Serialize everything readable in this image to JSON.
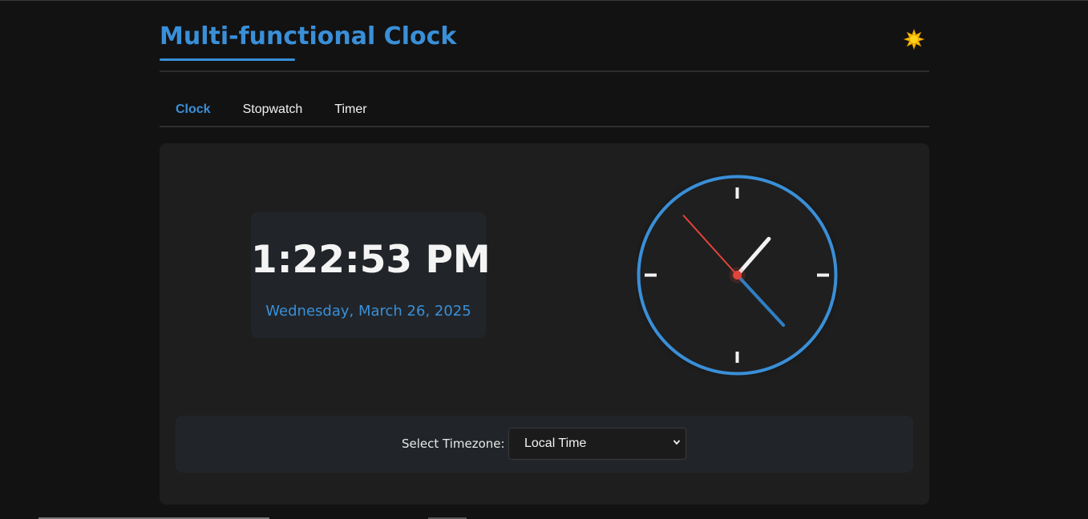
{
  "header": {
    "title": "Multi-functional Clock",
    "theme_toggle_icon": "sun-icon"
  },
  "tabs": [
    {
      "label": "Clock",
      "active": true
    },
    {
      "label": "Stopwatch",
      "active": false
    },
    {
      "label": "Timer",
      "active": false
    }
  ],
  "clock": {
    "digital_time": "1:22:53 PM",
    "date": "Wednesday, March 26, 2025",
    "analog": {
      "hours": 13,
      "minutes": 22,
      "seconds": 53
    }
  },
  "timezone": {
    "label": "Select Timezone:",
    "selected": "Local Time"
  },
  "colors": {
    "accent": "#3a8fd8",
    "second_hand": "#e0443a",
    "background": "#121212",
    "panel": "#1e1e1e",
    "sun": "#f5c400"
  }
}
